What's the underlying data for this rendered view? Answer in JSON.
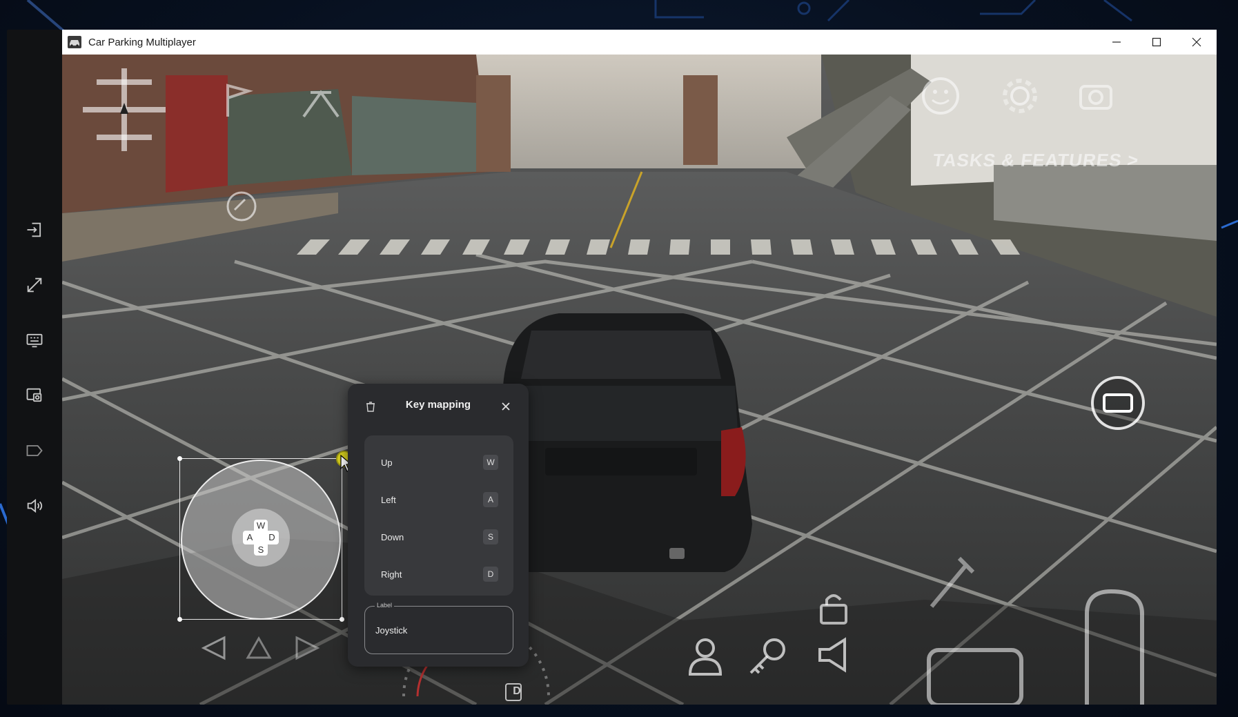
{
  "window": {
    "title": "Car Parking Multiplayer",
    "minimize_icon": "minimize-icon",
    "maximize_icon": "maximize-icon",
    "close_icon": "close-icon"
  },
  "side_toolbar": {
    "items": [
      {
        "icon": "sign-in-icon"
      },
      {
        "icon": "expand-icon"
      },
      {
        "icon": "keyboard-mapping-icon"
      },
      {
        "icon": "screenshot-icon"
      },
      {
        "icon": "label-icon"
      },
      {
        "icon": "volume-icon"
      }
    ]
  },
  "hud": {
    "tasks_text": "TASKS & FEATURES >",
    "gear_indicator": "D"
  },
  "joystick": {
    "keys": {
      "up": "W",
      "left": "A",
      "down": "S",
      "right": "D"
    }
  },
  "key_mapping": {
    "title": "Key mapping",
    "rows": [
      {
        "label": "Up",
        "key": "W"
      },
      {
        "label": "Left",
        "key": "A"
      },
      {
        "label": "Down",
        "key": "S"
      },
      {
        "label": "Right",
        "key": "D"
      }
    ],
    "label_field": {
      "legend": "Label",
      "value": "Joystick"
    }
  },
  "colors": {
    "panel_bg": "#2a2b2e",
    "resize_knob": "#d6cf1e",
    "toolbar_bg": "#111214"
  }
}
